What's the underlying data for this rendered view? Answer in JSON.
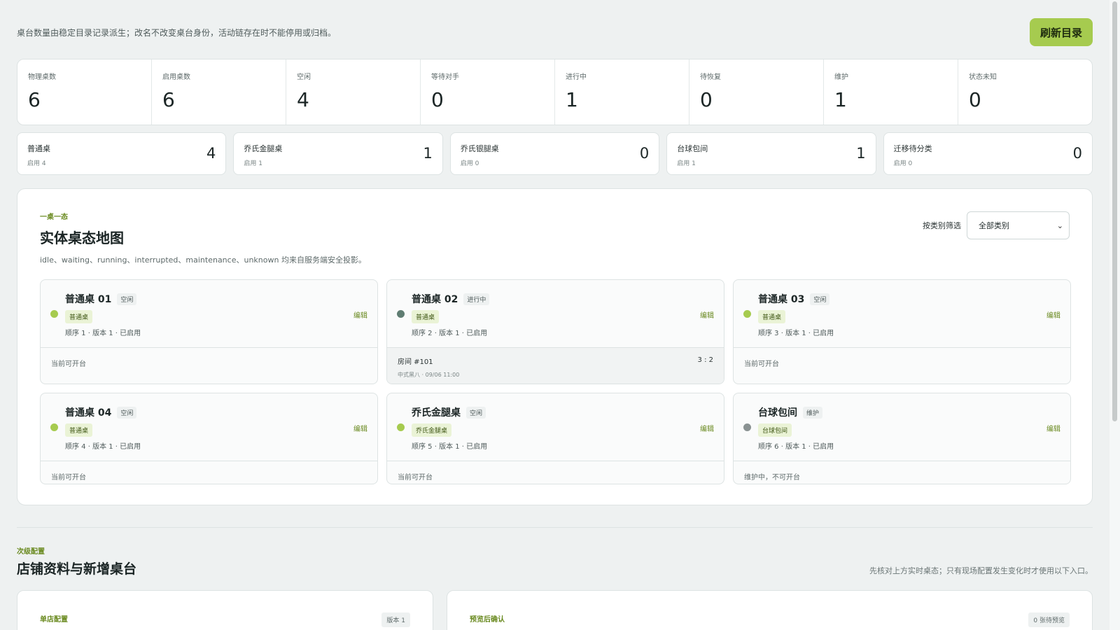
{
  "header": {
    "note": "桌台数量由稳定目录记录派生；改名不改变桌台身份，活动链存在时不能停用或归档。",
    "refresh_label": "刷新目录"
  },
  "stats": [
    {
      "label": "物理桌数",
      "value": "6"
    },
    {
      "label": "启用桌数",
      "value": "6"
    },
    {
      "label": "空闲",
      "value": "4"
    },
    {
      "label": "等待对手",
      "value": "0"
    },
    {
      "label": "进行中",
      "value": "1"
    },
    {
      "label": "待恢复",
      "value": "0"
    },
    {
      "label": "维护",
      "value": "1"
    },
    {
      "label": "状态未知",
      "value": "0"
    }
  ],
  "categories": [
    {
      "name": "普通桌",
      "enabled": "启用 4",
      "count": "4"
    },
    {
      "name": "乔氏金腿桌",
      "enabled": "启用 1",
      "count": "1"
    },
    {
      "name": "乔氏银腿桌",
      "enabled": "启用 0",
      "count": "0"
    },
    {
      "name": "台球包间",
      "enabled": "启用 1",
      "count": "1"
    },
    {
      "name": "迁移待分类",
      "enabled": "启用 0",
      "count": "0"
    }
  ],
  "map": {
    "eyebrow": "一桌一态",
    "title": "实体桌态地图",
    "desc": "idle、waiting、running、interrupted、maintenance、unknown 均来自服务端安全投影。",
    "filter_label": "按类别筛选",
    "filter_value": "全部类别",
    "edit_label": "编辑",
    "tables": [
      {
        "name": "普通桌 01",
        "status": "空闲",
        "category": "普通桌",
        "meta": "顺序 1 · 版本 1 · 已启用",
        "bottom": "当前可开台"
      },
      {
        "name": "普通桌 02",
        "status": "进行中",
        "category": "普通桌",
        "meta": "顺序 2 · 版本 1 · 已启用",
        "room": "房间 #101",
        "room_sub": "中式黑八 · 09/06 11:00",
        "score": "3 : 2"
      },
      {
        "name": "普通桌 03",
        "status": "空闲",
        "category": "普通桌",
        "meta": "顺序 3 · 版本 1 · 已启用",
        "bottom": "当前可开台"
      },
      {
        "name": "普通桌 04",
        "status": "空闲",
        "category": "普通桌",
        "meta": "顺序 4 · 版本 1 · 已启用",
        "bottom": "当前可开台"
      },
      {
        "name": "乔氏金腿桌",
        "status": "空闲",
        "category": "乔氏金腿桌",
        "meta": "顺序 5 · 版本 1 · 已启用",
        "bottom": "当前可开台"
      },
      {
        "name": "台球包间",
        "status": "维护",
        "category": "台球包间",
        "meta": "顺序 6 · 版本 1 · 已启用",
        "bottom": "维护中，不可开台"
      }
    ]
  },
  "secondary": {
    "eyebrow": "次级配置",
    "title": "店铺资料与新增桌台",
    "note": "先核对上方实时桌态；只有现场配置发生变化时才使用以下入口。",
    "left_eyebrow": "单店配置",
    "left_badge": "版本 1",
    "right_eyebrow": "预览后确认",
    "right_badge": "0 张待预览"
  },
  "colors": {
    "accent": "#a6cb4f",
    "idle_dot": "#a6cb4f",
    "running_dot": "#5f7d72",
    "maintenance_dot": "#8a9292"
  }
}
